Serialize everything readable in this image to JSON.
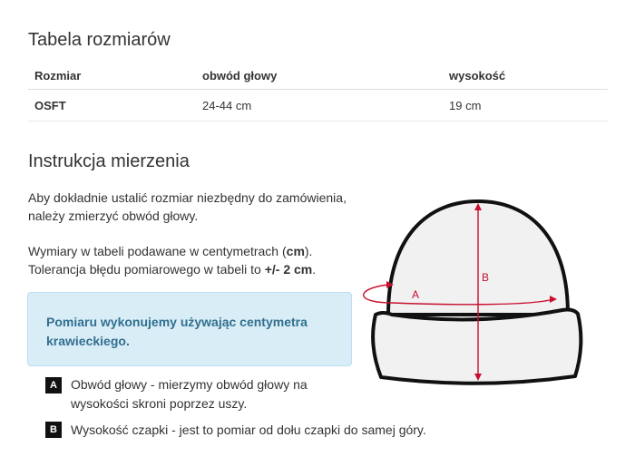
{
  "size_table": {
    "title": "Tabela rozmiarów",
    "headers": [
      "Rozmiar",
      "obwód głowy",
      "wysokość"
    ],
    "rows": [
      [
        "OSFT",
        "24-44 cm",
        "19 cm"
      ]
    ]
  },
  "instructions": {
    "title": "Instrukcja mierzenia",
    "para1_line1": "Aby dokładnie ustalić rozmiar niezbędny do zamówienia,",
    "para1_line2": "należy zmierzyć obwód głowy.",
    "para2_line1_a": "Wymiary w tabeli podawane w centymetrach (",
    "para2_line1_b": "cm",
    "para2_line1_c": ").",
    "para2_line2_a": "Tolerancja błędu pomiarowego w tabeli to ",
    "para2_line2_b": "+/- 2 cm",
    "para2_line2_c": ".",
    "info_line1": "Pomiaru wykonujemy używając centymetra",
    "info_line2": "krawieckiego.",
    "info_color": "#31708f",
    "info_bg": "#d9edf7"
  },
  "legend": [
    {
      "letter": "A",
      "line1": "Obwód głowy - mierzymy obwód głowy na",
      "line2": "wysokości skroni poprzez uszy."
    },
    {
      "letter": "B",
      "line1": "Wysokość czapki - jest to pomiar od dołu czapki do samej góry."
    }
  ],
  "diagram": {
    "label_a": "A",
    "label_b": "B",
    "accent_color": "#c8102e",
    "icon": "beanie-hat-diagram"
  }
}
